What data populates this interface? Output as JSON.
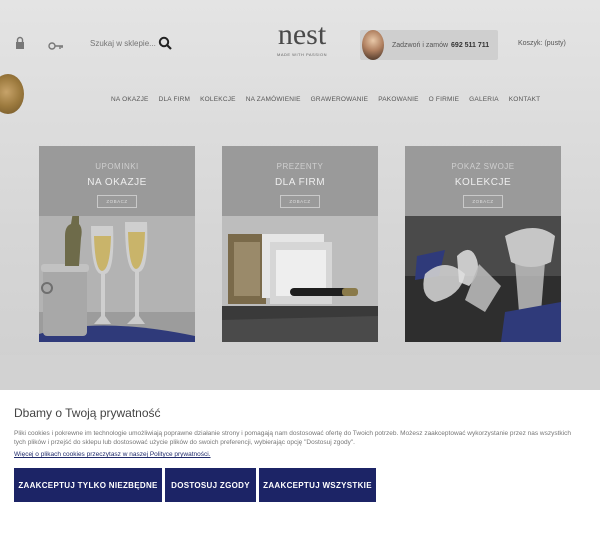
{
  "header": {
    "search_placeholder": "Szukaj w sklepie...",
    "logo_word": "nest",
    "logo_tagline": "MADE WITH PASSION",
    "call_text": "Zadzwoń i zamów",
    "call_phone": "692 511 711",
    "cart_label": "Koszyk: (pusty)"
  },
  "nav": {
    "items": [
      "NA OKAZJE",
      "DLA FIRM",
      "KOLEKCJE",
      "NA ZAMÓWIENIE",
      "GRAWEROWANIE",
      "PAKOWANIE",
      "O FIRMIE",
      "GALERIA",
      "KONTAKT"
    ]
  },
  "tiles": [
    {
      "kicker": "UPOMINKI",
      "title": "NA OKAZJE",
      "button": "ZOBACZ"
    },
    {
      "kicker": "PREZENTY",
      "title": "DLA FIRM",
      "button": "ZOBACZ"
    },
    {
      "kicker": "POKAŻ SWOJE",
      "title": "KOLEKCJE",
      "button": "ZOBACZ"
    }
  ],
  "cookie": {
    "title": "Dbamy o Twoją prywatność",
    "text": "Pliki cookies i pokrewne im technologie umożliwiają poprawne działanie strony i pomagają nam dostosować ofertę do Twoich potrzeb. Możesz zaakceptować wykorzystanie przez nas wszystkich tych plików i przejść do sklepu lub dostosować użycie plików do swoich preferencji, wybierając opcję \"Dostosuj zgody\".",
    "link": "Więcej o plikach cookies przeczytasz w naszej Polityce prywatności.",
    "btn_necessary": "ZAAKCEPTUJ TYLKO NIEZBĘDNE",
    "btn_customize": "DOSTOSUJ ZGODY",
    "btn_all": "ZAAKCEPTUJ WSZYSTKIE"
  },
  "colors": {
    "primary_button": "#1c2466",
    "overlay": "#d6d6d6"
  }
}
